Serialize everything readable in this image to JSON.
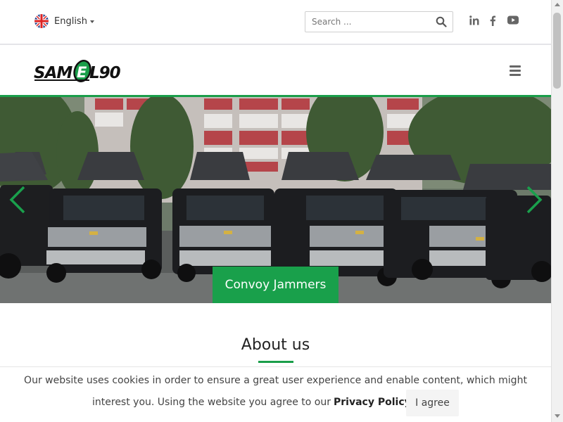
{
  "topbar": {
    "language": {
      "label": "English",
      "flag": "uk-flag-icon"
    },
    "search": {
      "placeholder": "Search ...",
      "icon": "search-icon"
    },
    "social": [
      {
        "name": "linkedin",
        "glyph": "in"
      },
      {
        "name": "facebook",
        "glyph": "f"
      },
      {
        "name": "youtube",
        "glyph": "youtube"
      }
    ]
  },
  "header": {
    "logo_text": "SAMEL90"
  },
  "hero": {
    "cta_label": "Convoy Jammers",
    "prev_icon": "chevron-left-icon",
    "next_icon": "chevron-right-icon"
  },
  "about": {
    "title": "About us"
  },
  "cookie": {
    "line1": "Our website uses cookies in order to ensure a great user experience and enable content, which might",
    "line2": "interest you. Using the website you agree to our",
    "policy_link": "Privacy Policy",
    "period": ".",
    "agree_label": "I agree"
  },
  "colors": {
    "accent": "#1a9e4a",
    "cta_bg": "#19a04b",
    "text": "#333333"
  }
}
